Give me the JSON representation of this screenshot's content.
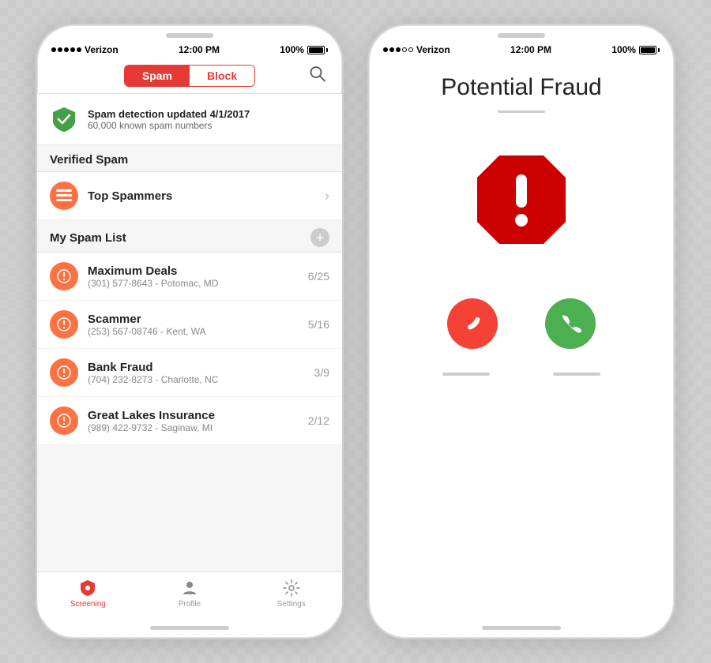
{
  "phone1": {
    "status": {
      "carrier": "Verizon",
      "time": "12:00 PM",
      "battery": "100%"
    },
    "segment": {
      "spam_label": "Spam",
      "block_label": "Block"
    },
    "update_banner": {
      "title": "Spam detection updated 4/1/2017",
      "subtitle": "60,000 known spam numbers"
    },
    "verified_spam_section": "Verified Spam",
    "top_spammers_label": "Top Spammers",
    "my_spam_list_section": "My Spam List",
    "spam_items": [
      {
        "name": "Maximum Deals",
        "detail": "(301) 577-8643 - Potomac, MD",
        "count": "6/25"
      },
      {
        "name": "Scammer",
        "detail": "(253) 567-08746 - Kent, WA",
        "count": "5/16"
      },
      {
        "name": "Bank Fraud",
        "detail": "(704) 232-8273 - Charlotte, NC",
        "count": "3/9"
      },
      {
        "name": "Great Lakes Insurance",
        "detail": "(989) 422-9732 - Saginaw, MI",
        "count": "2/12"
      }
    ],
    "nav": {
      "screening": "Screening",
      "profile": "Profile",
      "settings": "Settings"
    }
  },
  "phone2": {
    "status": {
      "carrier": "Verizon",
      "time": "12:00 PM",
      "battery": "100%"
    },
    "fraud_title": "Potential Fraud"
  }
}
